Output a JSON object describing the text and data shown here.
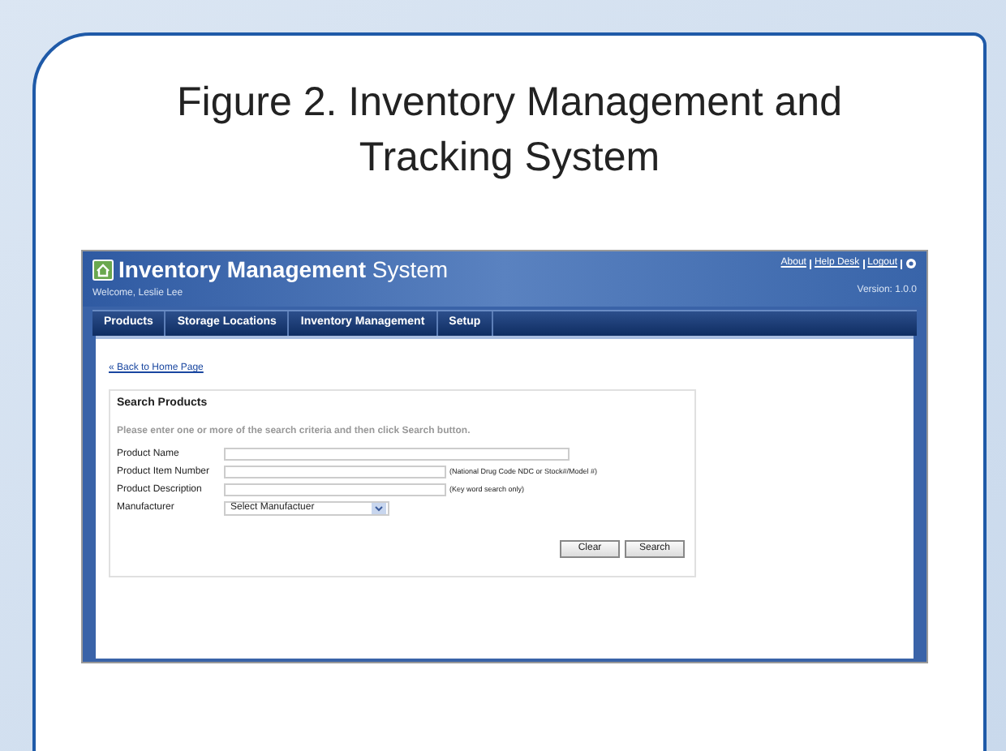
{
  "figure_title": "Figure 2. Inventory Management and Tracking System",
  "app": {
    "title_bold": "Inventory Management",
    "title_light": "System",
    "welcome": "Welcome, Leslie Lee",
    "top_links": [
      "About",
      "Help Desk",
      "Logout"
    ],
    "version": "Version: 1.0.0",
    "tabs": [
      {
        "label": "Products"
      },
      {
        "label": "Storage Locations"
      },
      {
        "label": "Inventory Management"
      },
      {
        "label": "Setup"
      }
    ],
    "back_link": "« Back to Home Page",
    "panel": {
      "title": "Search Products",
      "instructions": "Please enter one or more of the search criteria and then click Search button.",
      "fields": [
        {
          "kind": "text",
          "label": "Product Name"
        },
        {
          "kind": "text",
          "label": "Product Item Number",
          "hint": "(National Drug Code NDC or Stock#/Model #)"
        },
        {
          "kind": "text",
          "label": "Product Description",
          "hint": "(Key word search only)"
        },
        {
          "kind": "select",
          "label": "Manufacturer",
          "value": "Select Manufactuer"
        }
      ],
      "buttons": [
        "Clear",
        "Search"
      ]
    }
  }
}
